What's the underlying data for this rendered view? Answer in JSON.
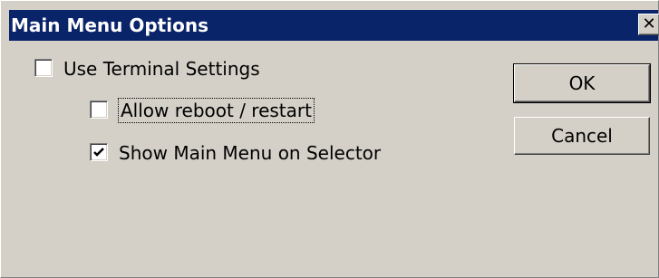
{
  "window": {
    "title": "Main Menu Options",
    "close_glyph": "✕",
    "titlebar_color": "#0a246a",
    "face_color": "#d4d0c8"
  },
  "options": {
    "use_terminal_settings": {
      "label": "Use Terminal Settings",
      "checked": false
    },
    "allow_reboot_restart": {
      "label": "Allow reboot / restart",
      "checked": false,
      "focused": true
    },
    "show_main_menu_on_selector": {
      "label": "Show Main Menu on Selector",
      "checked": true
    }
  },
  "buttons": {
    "ok_label": "OK",
    "cancel_label": "Cancel"
  }
}
